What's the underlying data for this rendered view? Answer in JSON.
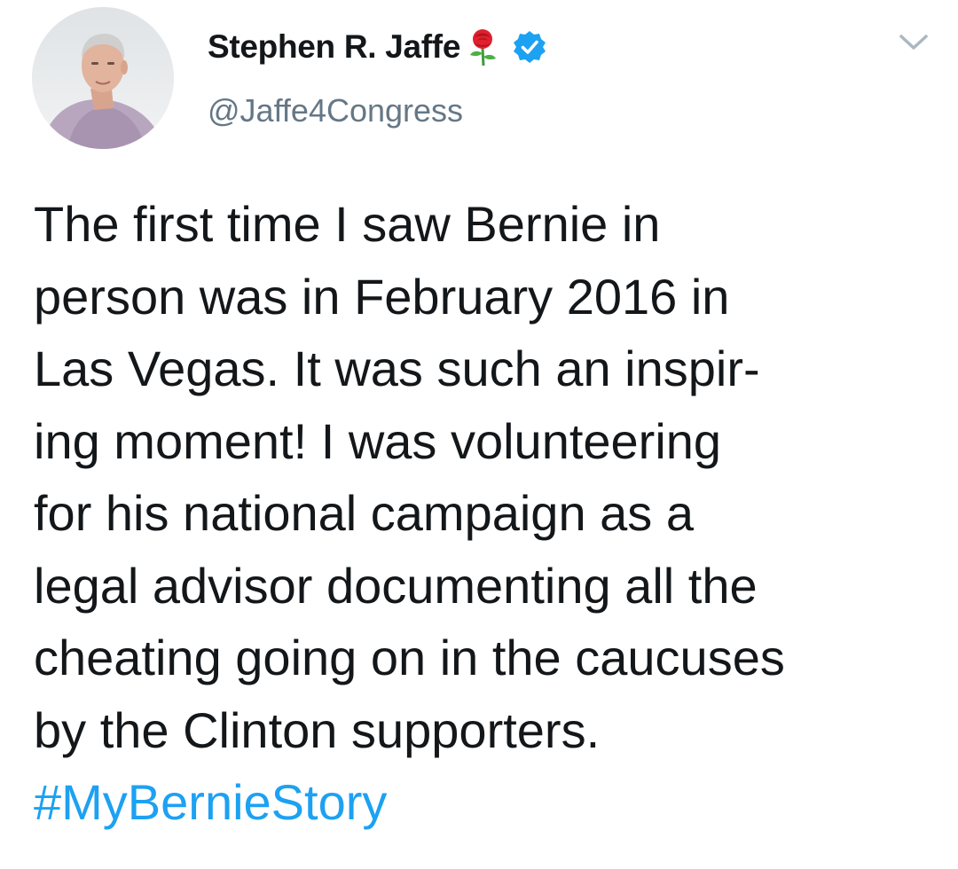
{
  "author": {
    "display_name": "Stephen R. Jaffe",
    "name_emoji": "rose-emoji",
    "verified": true,
    "handle": "@Jaffe4Congress",
    "avatar": "profile-photo"
  },
  "menu": {
    "icon": "chevron-down-icon"
  },
  "tweet": {
    "lines": [
      "The first time I saw Bernie in",
      "person was in February 2016 in",
      "Las Vegas. It was such an inspir-",
      "ing moment! I was volunteering",
      "for his national campaign as a",
      "legal advisor documenting all the",
      "cheating going on in the caucuses",
      "by the Clinton supporters."
    ],
    "hashtag": "#MyBernieStory"
  },
  "colors": {
    "text": "#14171a",
    "secondary": "#657786",
    "link": "#1da1f2",
    "verified": "#1da1f2",
    "chevron": "#aab8c2"
  }
}
